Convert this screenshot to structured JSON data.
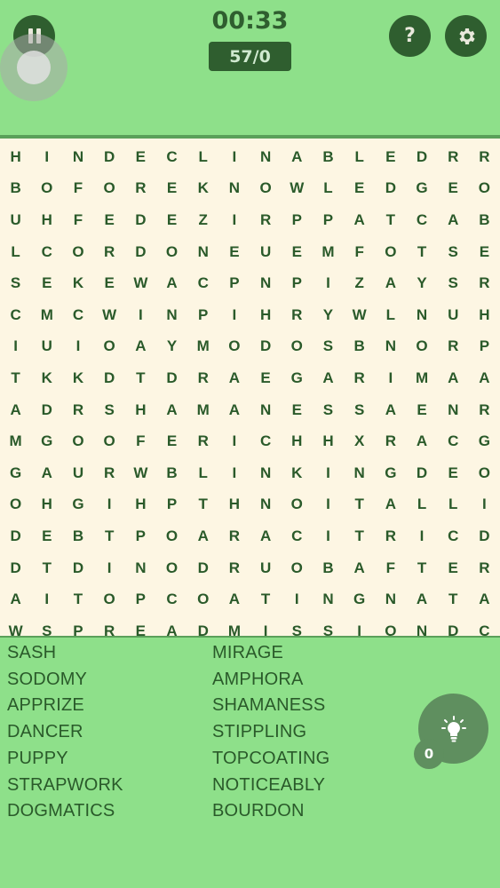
{
  "header": {
    "timer": "00:33",
    "score": "57/0",
    "help_label": "?"
  },
  "grid": [
    "HINDECLINABLEDRR",
    "BOFOREKNOWLEDGEO",
    "UHFEDEZIRPPATCAB",
    "LCORDONEUEMFOTSE",
    "SEKEWACPNPIZAYSR",
    "CMCWINPIHRYWLNUH",
    "IUIOAYMODOSBNORP",
    "TKKDTDRAEGARIMAA",
    "ADRSHAMANESSAENR",
    "MGOOFERICHHXRACG",
    "GAURWBLINKINGDEO",
    "OHGIHPTHNOITALLI",
    "DEBTPOARACITRICD",
    "DTDINODRUOBAFTER",
    "AITOPCOATINGNATA",
    "WSPREADMISSIONDC"
  ],
  "words_left": [
    "SASH",
    "SODOMY",
    "APPRIZE",
    "DANCER",
    "PUPPY",
    "STRAPWORK",
    "DOGMATICS"
  ],
  "words_right": [
    "MIRAGE",
    "AMPHORA",
    "SHAMANESS",
    "STIPPLING",
    "TOPCOATING",
    "NOTICEABLY",
    "BOURDON"
  ],
  "hint": {
    "count": "0"
  },
  "colors": {
    "background": "#8ee08a",
    "dark": "#2f5e2f",
    "grid_bg": "#fdf6e3",
    "letter": "#2a5a2a"
  }
}
